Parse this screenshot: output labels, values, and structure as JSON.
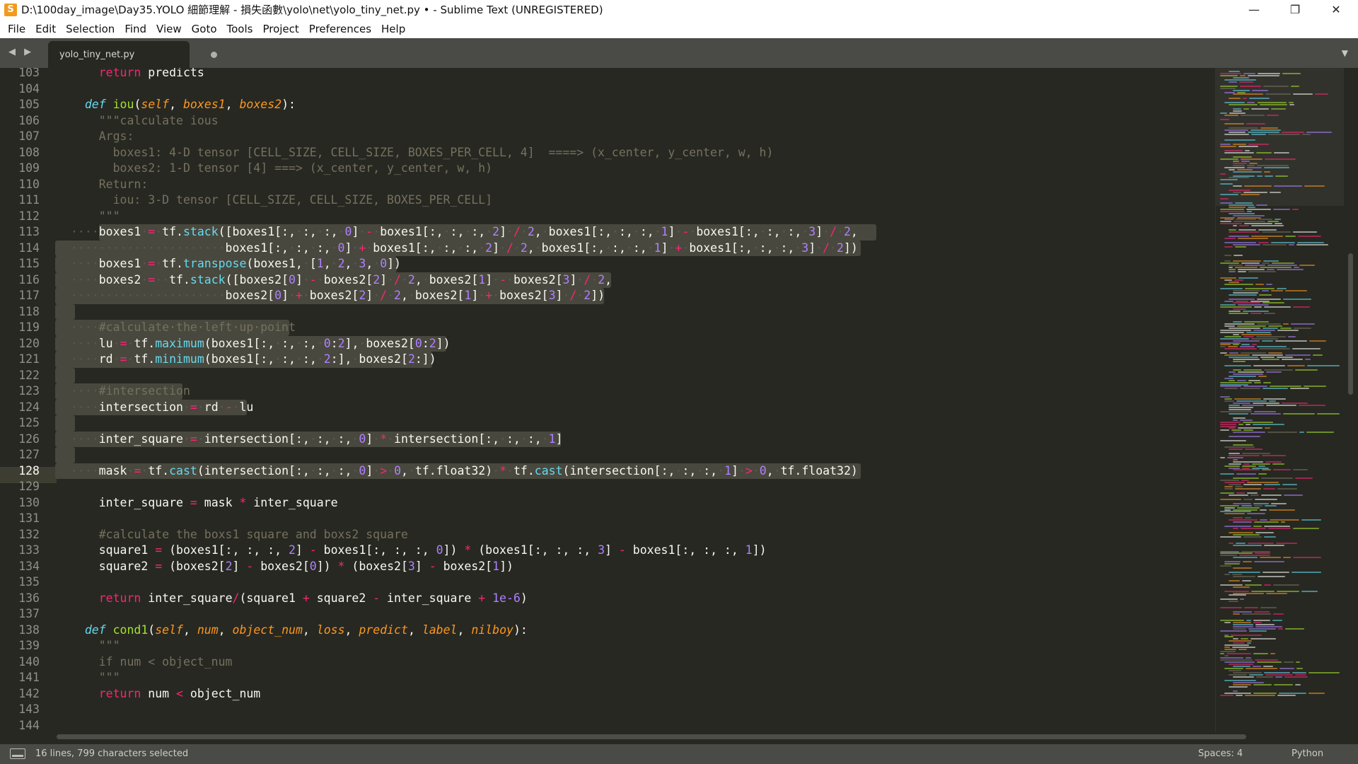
{
  "window": {
    "app_icon_glyph": "S",
    "title": "D:\\100day_image\\Day35.YOLO 細節理解 - 損失函數\\yolo\\net\\yolo_tiny_net.py • - Sublime Text (UNREGISTERED)",
    "minimize_glyph": "—",
    "maximize_glyph": "❐",
    "close_glyph": "✕"
  },
  "menu": {
    "items": [
      "File",
      "Edit",
      "Selection",
      "Find",
      "View",
      "Goto",
      "Tools",
      "Project",
      "Preferences",
      "Help"
    ]
  },
  "tabs": {
    "nav_arrows": "◀ ▶",
    "items": [
      {
        "label": "yolo_tiny_net.py",
        "modified": true
      }
    ],
    "menu_glyph": "▼"
  },
  "editor": {
    "first_line_number": 103,
    "active_line": 128,
    "line_numbers": [
      "103",
      "104",
      "105",
      "106",
      "107",
      "108",
      "109",
      "110",
      "111",
      "112",
      "113",
      "114",
      "115",
      "116",
      "117",
      "118",
      "119",
      "120",
      "121",
      "122",
      "123",
      "124",
      "125",
      "126",
      "127",
      "128",
      "129",
      "130",
      "131",
      "132",
      "133",
      "134",
      "135",
      "136",
      "137",
      "138",
      "139",
      "140",
      "141",
      "142",
      "143",
      "144"
    ],
    "selected_line_range": [
      113,
      128
    ],
    "lines": [
      "    return predicts",
      "",
      "  def iou(self, boxes1, boxes2):",
      "    \"\"\"calculate ious",
      "    Args:",
      "      boxes1: 4-D tensor [CELL_SIZE, CELL_SIZE, BOXES_PER_CELL, 4]  ====> (x_center, y_center, w, h)",
      "      boxes2: 1-D tensor [4] ===> (x_center, y_center, w, h)",
      "    Return:",
      "      iou: 3-D tensor [CELL_SIZE, CELL_SIZE, BOXES_PER_CELL]",
      "    \"\"\"",
      "    boxes1 = tf.stack([boxes1[:, :, :, 0] - boxes1[:, :, :, 2] / 2, boxes1[:, :, :, 1] - boxes1[:, :, :, 3] / 2,",
      "                      boxes1[:, :, :, 0] + boxes1[:, :, :, 2] / 2, boxes1[:, :, :, 1] + boxes1[:, :, :, 3] / 2])",
      "    boxes1 = tf.transpose(boxes1, [1, 2, 3, 0])",
      "    boxes2 =  tf.stack([boxes2[0] - boxes2[2] / 2, boxes2[1] - boxes2[3] / 2,",
      "                      boxes2[0] + boxes2[2] / 2, boxes2[1] + boxes2[3] / 2])",
      "",
      "    #calculate the left up point",
      "    lu = tf.maximum(boxes1[:, :, :, 0:2], boxes2[0:2])",
      "    rd = tf.minimum(boxes1[:, :, :, 2:], boxes2[2:])",
      "",
      "    #intersection",
      "    intersection = rd - lu",
      "",
      "    inter_square = intersection[:, :, :, 0] * intersection[:, :, :, 1]",
      "",
      "    mask = tf.cast(intersection[:, :, :, 0] > 0, tf.float32) * tf.cast(intersection[:, :, :, 1] > 0, tf.float32)",
      "",
      "    inter_square = mask * inter_square",
      "",
      "    #calculate the boxs1 square and boxs2 square",
      "    square1 = (boxes1[:, :, :, 2] - boxes1[:, :, :, 0]) * (boxes1[:, :, :, 3] - boxes1[:, :, :, 1])",
      "    square2 = (boxes2[2] - boxes2[0]) * (boxes2[3] - boxes2[1])",
      "",
      "    return inter_square/(square1 + square2 - inter_square + 1e-6)",
      "",
      "  def cond1(self, num, object_num, loss, predict, label, nilboy):",
      "    \"\"\"",
      "    if num < object_num",
      "    \"\"\"",
      "    return num < object_num",
      "",
      ""
    ]
  },
  "colors": {
    "background": "#272822",
    "selection": "#49483e",
    "keyword": "#f92672",
    "function": "#a6e22e",
    "storage": "#66d9ef",
    "parameter": "#fd971f",
    "number": "#ae81ff",
    "comment": "#75715e"
  },
  "status": {
    "selection_text": "16 lines, 799 characters selected",
    "indentation": "Spaces: 4",
    "syntax": "Python"
  }
}
